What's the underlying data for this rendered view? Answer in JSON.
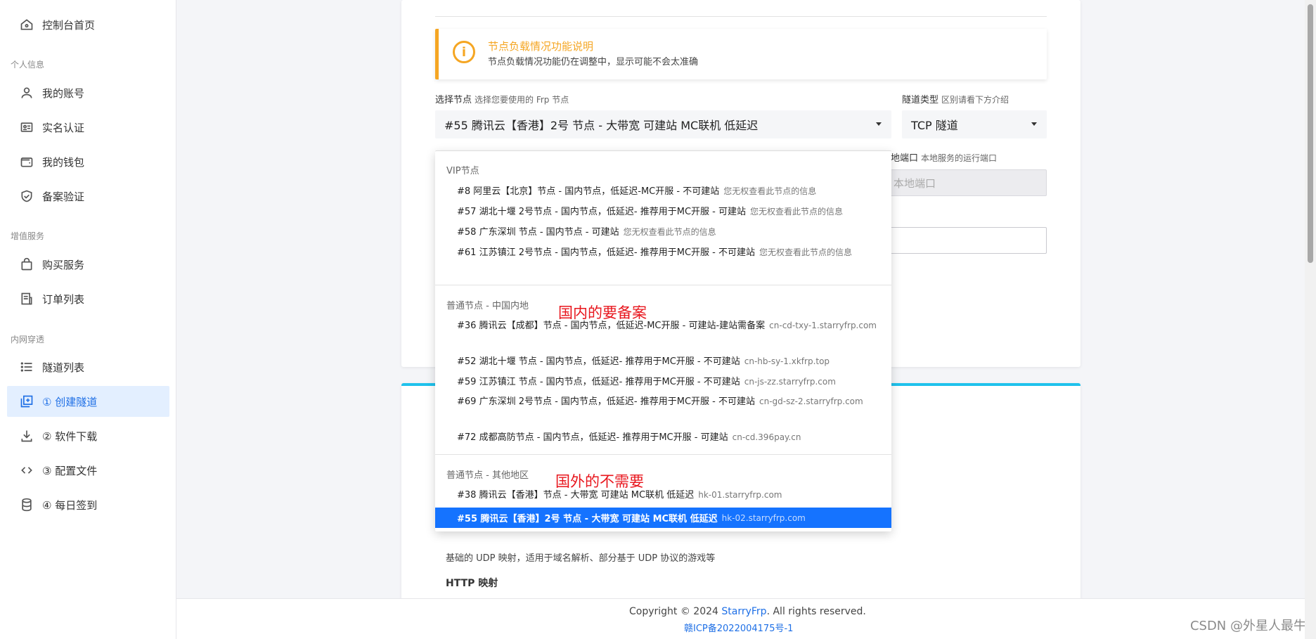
{
  "sidebar": {
    "home": "控制台首页",
    "section_personal": "个人信息",
    "account": "我的账号",
    "realname": "实名认证",
    "wallet": "我的钱包",
    "beian": "备案验证",
    "section_value": "增值服务",
    "buy": "购买服务",
    "orders": "订单列表",
    "section_tunnel": "内网穿透",
    "tunnel_list": "隧道列表",
    "create_tunnel": "① 创建隧道",
    "download": "② 软件下载",
    "config": "③ 配置文件",
    "signin": "④ 每日签到"
  },
  "alert": {
    "title": "节点负载情况功能说明",
    "text": "节点负载情况功能仍在调整中，显示可能不会太准确"
  },
  "form": {
    "node_label": "选择节点",
    "node_hint": "选择您要使用的 Frp 节点",
    "node_value": "#55 腾讯云【香港】2号 节点 - 大带宽 可建站 MC联机 低延迟",
    "type_label": "隧道类型",
    "type_hint": "区别请看下方介绍",
    "type_value": "TCP 隧道",
    "local_port_label": "地端口",
    "local_port_hint": "本地服务的运行端口",
    "local_port_placeholder": "本地端口"
  },
  "dropdown": {
    "group_vip": "VIP节点",
    "vip": [
      {
        "name": "#8 阿里云【北京】节点 - 国内节点，低延迟-MC开服 - 不可建站",
        "sub": "您无权查看此节点的信息"
      },
      {
        "name": "#57 湖北十堰 2号节点 - 国内节点，低延迟- 推荐用于MC开服 - 可建站",
        "sub": "您无权查看此节点的信息"
      },
      {
        "name": "#58 广东深圳 节点 - 国内节点 - 可建站",
        "sub": "您无权查看此节点的信息"
      },
      {
        "name": "#61 江苏镇江 2号节点 - 国内节点，低延迟- 推荐用于MC开服 - 不可建站",
        "sub": "您无权查看此节点的信息"
      }
    ],
    "group_cn": "普通节点 - 中国内地",
    "cn": [
      {
        "name": "#36 腾讯云【成都】节点 - 国内节点，低延迟-MC开服 - 可建站-建站需备案",
        "sub": "cn-cd-txy-1.starryfrp.com"
      },
      {
        "name": "#52 湖北十堰 节点 - 国内节点，低延迟- 推荐用于MC开服 - 不可建站",
        "sub": "cn-hb-sy-1.xkfrp.top"
      },
      {
        "name": "#59 江苏镇江 节点 - 国内节点，低延迟- 推荐用于MC开服 - 不可建站",
        "sub": "cn-js-zz.starryfrp.com"
      },
      {
        "name": "#69 广东深圳 2号节点 - 国内节点，低延迟- 推荐用于MC开服 - 不可建站",
        "sub": "cn-gd-sz-2.starryfrp.com"
      },
      {
        "name": "#72 成都高防节点 - 国内节点，低延迟- 推荐用于MC开服 - 可建站",
        "sub": "cn-cd.396pay.cn"
      }
    ],
    "group_other": "普通节点 - 其他地区",
    "other": [
      {
        "name": "#38 腾讯云【香港】节点 - 大带宽 可建站 MC联机 低延迟",
        "sub": "hk-01.starryfrp.com"
      }
    ],
    "selected": {
      "name": "#55 腾讯云【香港】2号 节点 - 大带宽 可建站 MC联机 低延迟",
      "sub": "hk-02.starryfrp.com"
    },
    "annot_cn": "国内的要备案",
    "annot_other": "国外的不需要"
  },
  "card2": {
    "udp_desc": "基础的 UDP 映射，适用于域名解析、部分基于 UDP 协议的游戏等",
    "http_title": "HTTP 映射"
  },
  "footer": {
    "copyright_pre": "Copyright © 2024 ",
    "brand": "StarryFrp",
    "copyright_post": ". All rights reserved.",
    "icp": "赣ICP备2022004175号-1"
  },
  "watermark": "CSDN @外星人最牛"
}
